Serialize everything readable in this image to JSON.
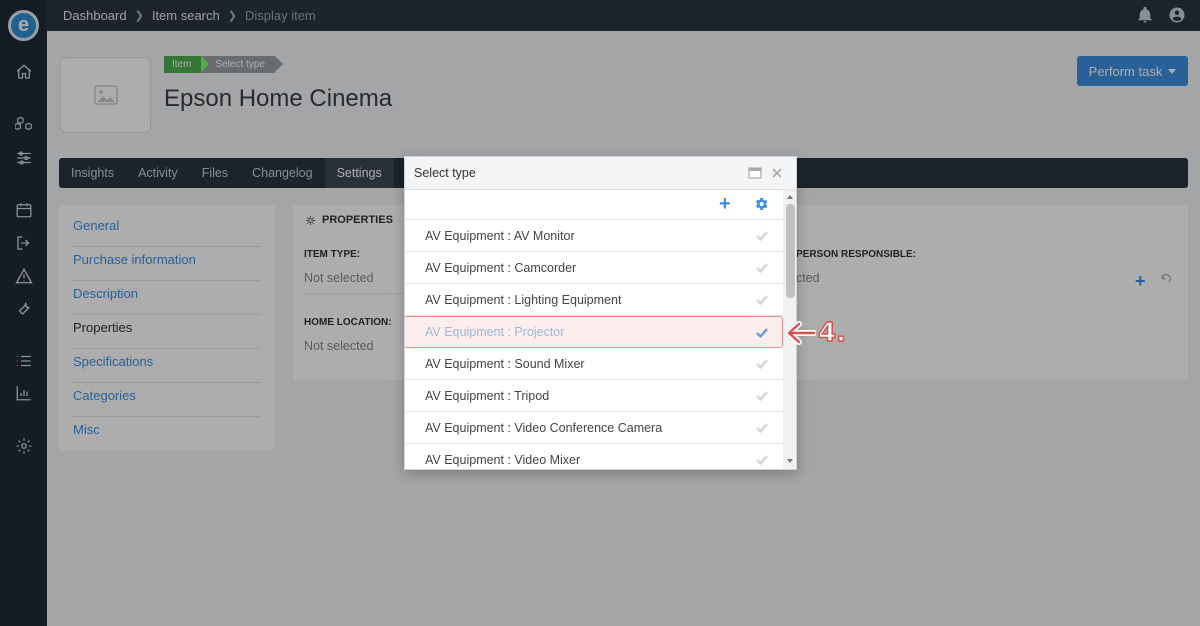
{
  "app": {
    "logo_letter": "e"
  },
  "breadcrumb": [
    {
      "label": "Dashboard"
    },
    {
      "label": "Item search"
    },
    {
      "label": "Display item"
    }
  ],
  "header": {
    "steps": [
      "Item",
      "Select type"
    ],
    "title": "Epson Home Cinema",
    "perform_task_label": "Perform task"
  },
  "tabs": [
    "Insights",
    "Activity",
    "Files",
    "Changelog",
    "Settings"
  ],
  "active_tab": "Settings",
  "left_nav": [
    "General",
    "Purchase information",
    "Description",
    "Properties",
    "Specifications",
    "Categories",
    "Misc"
  ],
  "active_nav": "Properties",
  "properties": {
    "title": "PROPERTIES",
    "item_type_label": "ITEM TYPE:",
    "item_type_value": "Not selected",
    "home_location_label": "HOME LOCATION:",
    "home_location_value": "Not selected",
    "person_label": "PERSON RESPONSIBLE:",
    "person_value": "cted"
  },
  "modal": {
    "title": "Select type",
    "items": [
      "AV Equipment : AV Monitor",
      "AV Equipment : Camcorder",
      "AV Equipment : Lighting Equipment",
      "AV Equipment : Projector",
      "AV Equipment : Sound Mixer",
      "AV Equipment : Tripod",
      "AV Equipment : Video Conference Camera",
      "AV Equipment : Video Mixer"
    ],
    "selected_index": 3
  },
  "annotation": {
    "label": "4."
  },
  "colors": {
    "accent": "#3a8fe0",
    "sidebar": "#1e2a38",
    "step_green": "#4fae4e",
    "highlight": "#e88a8a"
  }
}
